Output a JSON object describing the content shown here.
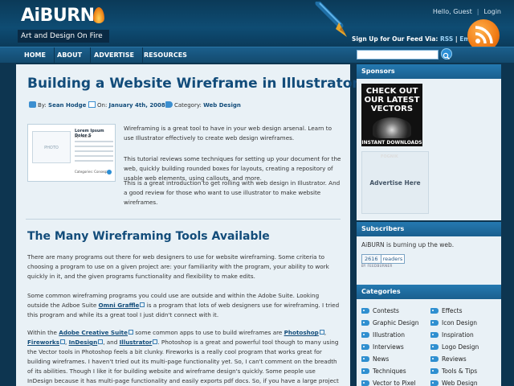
{
  "header": {
    "logo_text": "AiBURN",
    "logo_tagline": "Art and Design On Fire",
    "greeting": "Hello, Guest",
    "login_label": "Login",
    "feed_prefix": "Sign Up for Our Feed Via:",
    "feed_rss": "RSS",
    "feed_sep": "|",
    "feed_email": "Email"
  },
  "nav": {
    "items": [
      "HOME",
      "ABOUT",
      "ADVERTISE",
      "RESOURCES"
    ],
    "search_placeholder": ""
  },
  "post": {
    "title": "Building a Website Wireframe in Illustrator",
    "author_prefix": "By:",
    "author": "Sean Hodge",
    "date_prefix": "On:",
    "date": "January 4th, 2008",
    "category_prefix": "Category:",
    "category": "Web Design",
    "thumb": {
      "photo_label": "PHOTO",
      "heading": "Lorem Ipsum Dolor S",
      "byline": "By: Author",
      "category_line": "Categories: Conseqat"
    },
    "intro_paragraphs": [
      "Wireframing is a great tool to have in your web design arsenal. Learn to use Illustrator effectively to create web design wireframes.",
      "This tutorial reviews some techniques for setting up your document for the web, quickly building rounded boxes for layouts, creating a repository of usable web elements, using callouts, and more.",
      "This is a great introduction to get rolling with web design in Illustrator. And a good review for those who want to use illustrator to make website wireframes."
    ],
    "section_heading": "The Many Wireframing Tools Available",
    "body_p1": "There are many programs out there for web designers to use for website wireframing. Some criteria to choosing a program to use on a given project are: your familiarity with the program, your ability to work quickly in it, and the given programs functionality and flexibility to make edits.",
    "body_p2_a": "Some common wireframing programs you could use are outside and within the Adobe Suite. Looking outside the Adboe Suite",
    "body_p2_link": "Omni Graffle",
    "body_p2_b": "is a program that lots of web designers use for wireframing. I tried this program and while its a great tool I just didn't connect with it.",
    "body_p3_a": "Within the",
    "link_suite": "Adobe Creative Suite",
    "body_p3_b": "some common apps to use to build wireframes are",
    "link_photoshop": "Photoshop",
    "link_fireworks": "Fireworks",
    "link_indesign": "InDesign",
    "body_p3_and": ", and",
    "link_illustrator": "Illustrator",
    "body_p3_c": ". Photoshop is a great and powerful tool though to many using the Vector tools in Photoshop feels a bit clunky. Fireworks is a really cool program that works great for building wireframes. I haven't tried out its multi-page functionality yet. So, I can't comment on the breadth of its abilities. Though I like it for building website and wireframe design's quickly. Some people use InDesign because it has multi-page functionality and easily exports pdf docs. So, if you have a large project that"
  },
  "sidebar": {
    "sponsors_title": "Sponsors",
    "ad_vector_text": "CHECK OUT OUR LATEST VECTORS",
    "ad_vector_brand": "FOGNIK",
    "ad_vector_bottom": "INSTANT DOWNLOADS",
    "ad_here": "Advertise Here",
    "subscribers_title": "Subscribers",
    "subscribers_text": "AiBURN is burning up the web.",
    "readers_count": "2616",
    "readers_label": "readers",
    "feedburner_label": "BY FEEDBURNER",
    "categories_title": "Categories",
    "categories_left": [
      "Contests",
      "Graphic Design",
      "Illustration",
      "Interviews",
      "News",
      "Techniques",
      "Vector to Pixel"
    ],
    "categories_right": [
      "Effects",
      "Icon Design",
      "Inspiration",
      "Logo Design",
      "Reviews",
      "Tools & Tips",
      "Web Design"
    ]
  },
  "colors": {
    "header_bg": "#0e4c73",
    "accent_blue": "#124c7a",
    "rss_orange": "#f07a14",
    "content_bg": "#e9f1f6"
  }
}
